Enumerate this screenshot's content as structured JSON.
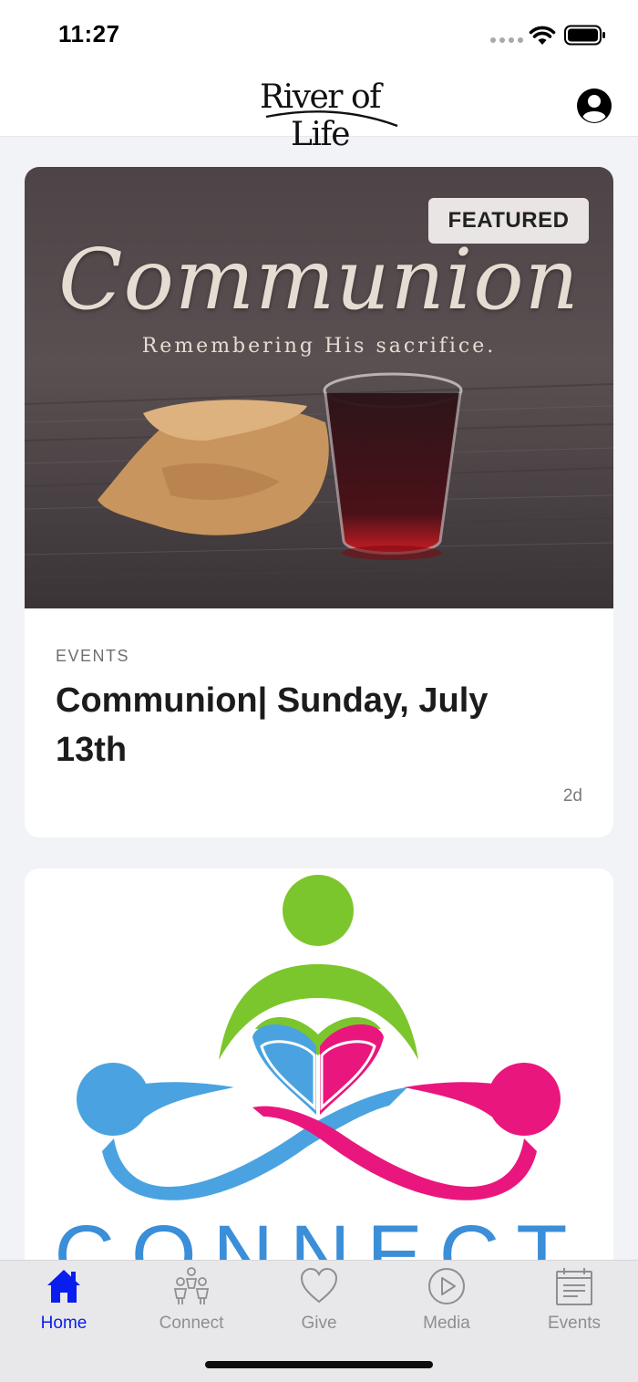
{
  "status_bar": {
    "time": "11:27"
  },
  "header": {
    "logo_text": "River of Life",
    "profile_icon": "user-circle-icon"
  },
  "feed": {
    "featured_card": {
      "badge": "FEATURED",
      "image_title": "Communion",
      "image_subtitle": "Remembering His sacrifice.",
      "category": "EVENTS",
      "title": "Communion| Sunday, July 13th",
      "age": "2d"
    },
    "second_card": {
      "image_word": "CONNECT"
    }
  },
  "tab_bar": {
    "active_color": "#0a1df0",
    "inactive_color": "#8e8e93",
    "tabs": [
      {
        "label": "Home",
        "icon": "home-icon",
        "active": true
      },
      {
        "label": "Connect",
        "icon": "people-icon",
        "active": false
      },
      {
        "label": "Give",
        "icon": "heart-icon",
        "active": false
      },
      {
        "label": "Media",
        "icon": "play-circle-icon",
        "active": false
      },
      {
        "label": "Events",
        "icon": "calendar-icon",
        "active": false
      }
    ]
  }
}
